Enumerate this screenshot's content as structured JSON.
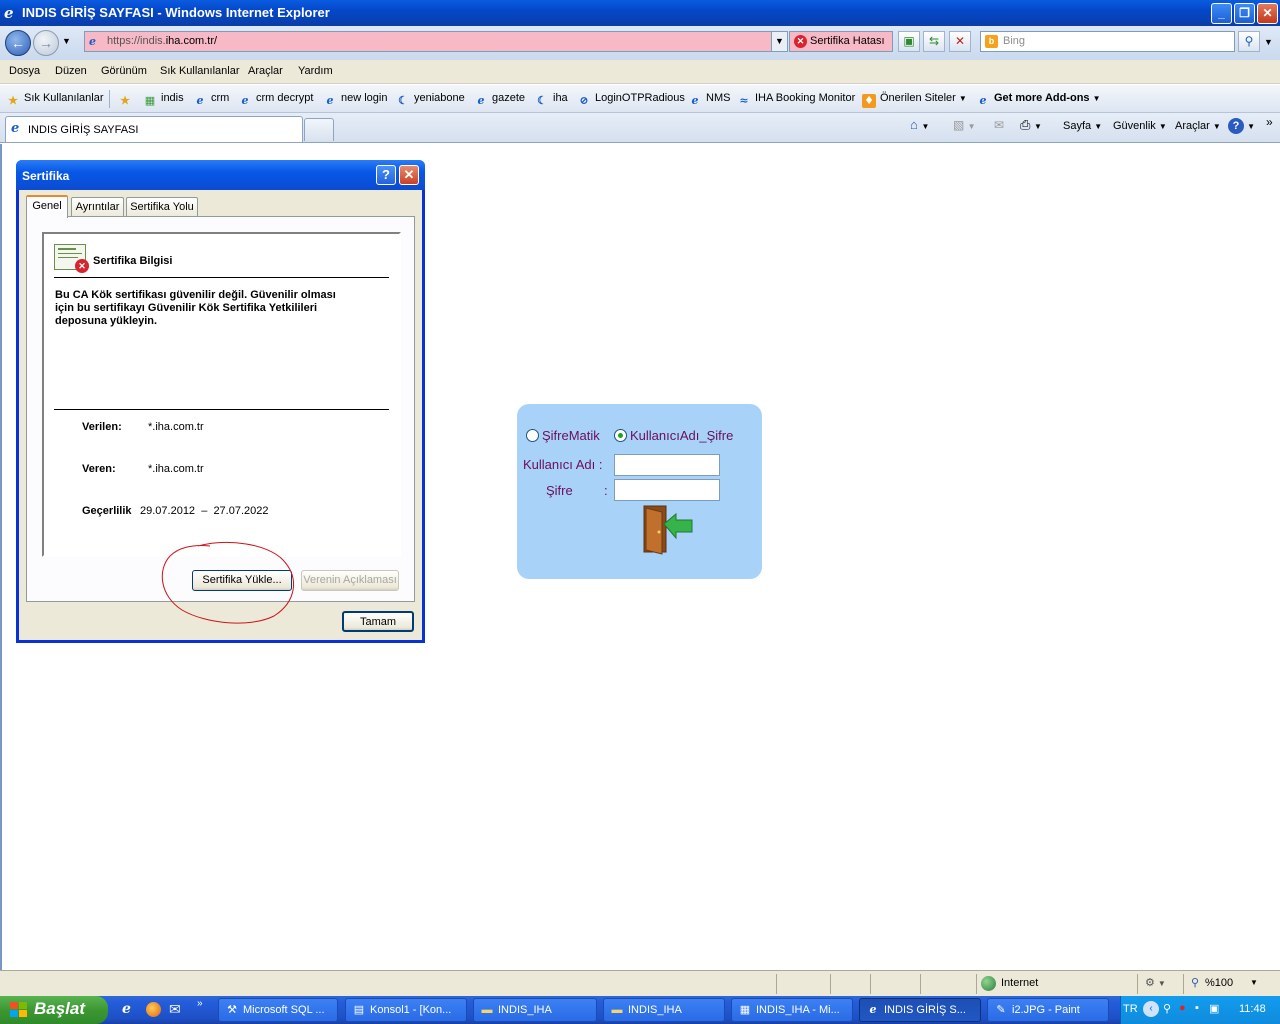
{
  "window": {
    "title": "INDIS GİRİŞ SAYFASI - Windows Internet Explorer"
  },
  "addressbar": {
    "url_prefix": "https://indis.",
    "url_domain": "iha.com.tr/",
    "cert_error": "Sertifika Hatası",
    "search_placeholder": "Bing"
  },
  "menu": [
    "Dosya",
    "Düzen",
    "Görünüm",
    "Sık Kullanılanlar",
    "Araçlar",
    "Yardım"
  ],
  "favorites": {
    "label": "Sık Kullanılanlar",
    "items": [
      "indis",
      "crm",
      "crm decrypt",
      "new login",
      "yeniabone",
      "gazete",
      "iha",
      "LoginOTPRadious",
      "NMS",
      "IHA Booking Monitor",
      "Önerilen Siteler",
      "Get more Add-ons"
    ]
  },
  "tabs": {
    "active_label": "INDIS GİRİŞ SAYFASI"
  },
  "commandbar": {
    "page": "Sayfa",
    "safety": "Güvenlik",
    "tools": "Araçlar"
  },
  "dialog": {
    "title": "Sertifika",
    "tabs": [
      "Genel",
      "Ayrıntılar",
      "Sertifika Yolu"
    ],
    "info_heading": "Sertifika Bilgisi",
    "warning_lines": [
      "Bu CA Kök sertifikası güvenilir değil. Güvenilir olması",
      "için bu sertifikayı Güvenilir Kök Sertifika Yetkilileri",
      "deposuna yükleyin."
    ],
    "issued_to_label": "Verilen:",
    "issued_to_value": "*.iha.com.tr",
    "issued_by_label": "Veren:",
    "issued_by_value": "*.iha.com.tr",
    "validity_label": "Geçerlilik",
    "validity_from": "29.07.2012",
    "validity_sep": "–",
    "validity_to": "27.07.2022",
    "install_button": "Sertifika Yükle...",
    "issuer_statement_button": "Verenin Açıklaması",
    "ok_button": "Tamam"
  },
  "login": {
    "option1": "ŞifreMatik",
    "option2": "KullanıcıAdı_Şifre",
    "selected": "KullanıcıAdı_Şifre",
    "username_label": "Kullanıcı Adı :",
    "password_label": "Şifre",
    "password_colon": ":",
    "username_value": "",
    "password_value": ""
  },
  "statusbar": {
    "zone": "Internet",
    "zoom": "%100"
  },
  "taskbar": {
    "start": "Başlat",
    "tasks": [
      "Microsoft SQL ...",
      "Konsol1 - [Kon...",
      "INDIS_IHA",
      "INDIS_IHA",
      "INDIS_IHA - Mi...",
      "INDIS GİRİŞ S...",
      "i2.JPG - Paint"
    ],
    "active_task_index": 5,
    "language": "TR",
    "clock": "11:48"
  },
  "colors": {
    "xp_blue": "#0a5ce0",
    "cert_error_bg": "#f7b9c5",
    "login_panel": "#a8d2f8",
    "login_text": "#6a0f5c",
    "annotation_red": "#d0121a"
  }
}
